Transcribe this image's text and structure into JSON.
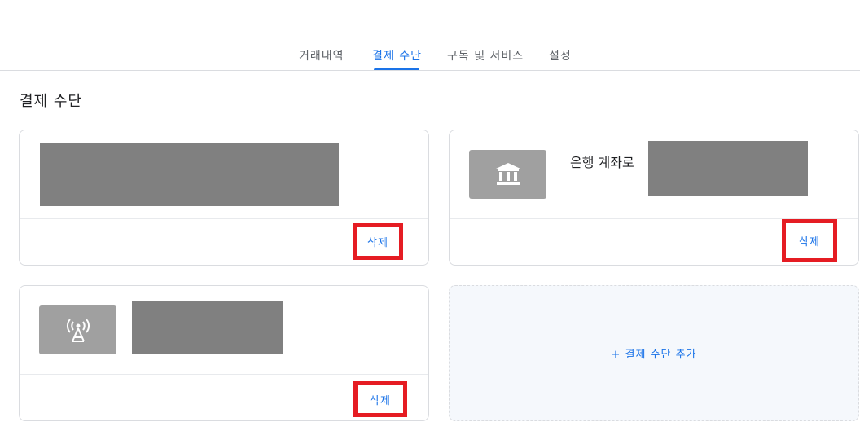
{
  "tabs": [
    {
      "label": "거래내역"
    },
    {
      "label": "결제 수단"
    },
    {
      "label": "구독 및 서비스"
    },
    {
      "label": "설정"
    }
  ],
  "active_tab": "결제 수단",
  "section": {
    "title": "결제 수단"
  },
  "cards": [
    {
      "delete_label": "삭제"
    },
    {
      "type_label": "은행 계좌로",
      "icon": "bank-icon",
      "delete_label": "삭제"
    },
    {
      "icon": "tower-icon",
      "delete_label": "삭제"
    }
  ],
  "add_payment": {
    "label": "+ 결제 수단 추가"
  },
  "colors": {
    "accent": "#1a73e8",
    "highlight_border": "#e51c23",
    "redaction": "#808080",
    "icon_tile": "#a0a0a0"
  }
}
